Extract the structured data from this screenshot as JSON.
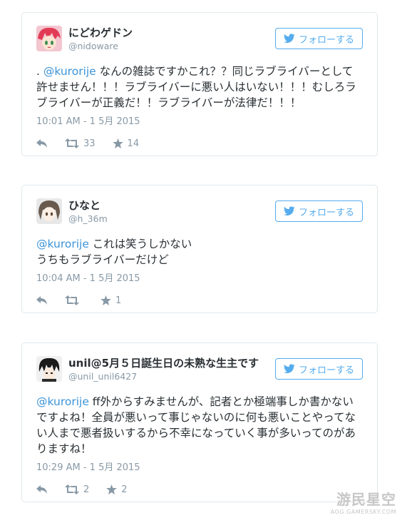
{
  "colors": {
    "link": "#3b94d9",
    "brand": "#55acee",
    "muted": "#8899a6",
    "text": "#292f33"
  },
  "follow_label": "フォローする",
  "tweets": [
    {
      "display_name": "にどわゲドン",
      "screen_name": "@nidoware",
      "text_prefix": ". ",
      "mention": "@kurorije",
      "text": " なんの雑誌ですかこれ？？同じラブライバーとして許せません！！！ラブライバーに悪い人はいない！！！むしろラブライバーが正義だ！！ラブライバーが法律だ！！！",
      "timestamp": "10:01 AM - 1 5月 2015",
      "retweets": "33",
      "favorites": "14"
    },
    {
      "display_name": "ひなと",
      "screen_name": "@h_36m",
      "text_prefix": "",
      "mention": "@kurorije",
      "text": " これは笑うしかない\nうちもラブライバーだけど",
      "timestamp": "10:04 AM - 1 5月 2015",
      "retweets": "",
      "favorites": "1"
    },
    {
      "display_name": "unil@5月５日誕生日の未熟な生主です",
      "screen_name": "@unil_unil6427",
      "text_prefix": "",
      "mention": "@kurorije",
      "text": " ff外からすみませんが、記者とか極端事しか書かないですよね！全員が悪いって事じゃないのに何も悪いことやってない人まで悪者扱いするから不幸になっていく事が多いってのがありますね！",
      "timestamp": "10:29 AM - 1 5月 2015",
      "retweets": "2",
      "favorites": "2"
    }
  ],
  "watermark": {
    "title": "游民星空",
    "url": "AOG.GAMERSKY.COM"
  }
}
